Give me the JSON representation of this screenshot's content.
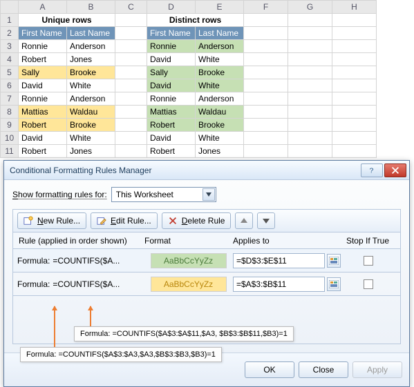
{
  "columns": [
    "A",
    "B",
    "C",
    "D",
    "E",
    "F",
    "G",
    "H"
  ],
  "rownums": [
    "1",
    "2",
    "3",
    "4",
    "5",
    "6",
    "7",
    "8",
    "9",
    "10",
    "11"
  ],
  "titles": {
    "unique": "Unique rows",
    "distinct": "Distinct rows"
  },
  "headers": {
    "first": "First Name",
    "last": "Last Name"
  },
  "rows": [
    {
      "f": "Ronnie",
      "l": "Anderson",
      "hlA": false,
      "hlD": true
    },
    {
      "f": "Robert",
      "l": "Jones",
      "hlA": false,
      "hlD": false
    },
    {
      "f": "Sally",
      "l": "Brooke",
      "hlA": true,
      "hlD": true
    },
    {
      "f": "David",
      "l": "White",
      "hlA": false,
      "hlD": true
    },
    {
      "f": "Ronnie",
      "l": "Anderson",
      "hlA": false,
      "hlD": false
    },
    {
      "f": "Mattias",
      "l": "Waldau",
      "hlA": true,
      "hlD": true
    },
    {
      "f": "Robert",
      "l": "Brooke",
      "hlA": true,
      "hlD": true
    },
    {
      "f": "David",
      "l": "White",
      "hlA": false,
      "hlD": false
    },
    {
      "f": "Robert",
      "l": "Jones",
      "hlA": false,
      "hlD": false
    }
  ],
  "rows_d3": {
    "f": "David",
    "l": "White"
  },
  "dialog": {
    "title": "Conditional Formatting Rules Manager",
    "show_label": "Show formatting rules for:",
    "scope": "This Worksheet",
    "new": "New Rule...",
    "edit": "Edit Rule...",
    "delete": "Delete Rule",
    "hdr": {
      "rule": "Rule (applied in order shown)",
      "format": "Format",
      "applies": "Applies to",
      "stop": "Stop If True"
    },
    "formula_prefix": "Formula:",
    "fmt_sample": "AaBbCcYyZz",
    "rules": [
      {
        "formula": "=COUNTIFS($A...",
        "applies": "=$D$3:$E$11",
        "style": "g"
      },
      {
        "formula": "=COUNTIFS($A...",
        "applies": "=$A$3:$B$11",
        "style": "y"
      }
    ],
    "ok": "OK",
    "close": "Close",
    "apply": "Apply"
  },
  "callouts": {
    "top": "Formula: =COUNTIFS($A$3:$A$11,$A3, $B$3:$B$11,$B3)=1",
    "bottom": "Formula: =COUNTIFS($A$3:$A3,$A3,$B$3:$B3,$B3)=1"
  },
  "chart_data": {
    "type": "table",
    "title": "Conditional Formatting Rules Manager (Excel)",
    "unique_rows_range": "$A$3:$B$11",
    "distinct_rows_range": "$D$3:$E$11",
    "data": [
      [
        "First Name",
        "Last Name"
      ],
      [
        "Ronnie",
        "Anderson"
      ],
      [
        "Robert",
        "Jones"
      ],
      [
        "Sally",
        "Brooke"
      ],
      [
        "David",
        "White"
      ],
      [
        "Ronnie",
        "Anderson"
      ],
      [
        "Mattias",
        "Waldau"
      ],
      [
        "Robert",
        "Brooke"
      ],
      [
        "David",
        "White"
      ],
      [
        "Robert",
        "Jones"
      ]
    ],
    "rules": [
      {
        "formula": "=COUNTIFS($A$3:$A$11,$A3, $B$3:$B$11,$B3)=1",
        "applies_to": "=$D$3:$E$11",
        "fill": "#c6e0b4"
      },
      {
        "formula": "=COUNTIFS($A$3:$A3,$A3,$B$3:$B3,$B3)=1",
        "applies_to": "=$A$3:$B$11",
        "fill": "#ffe699"
      }
    ]
  }
}
